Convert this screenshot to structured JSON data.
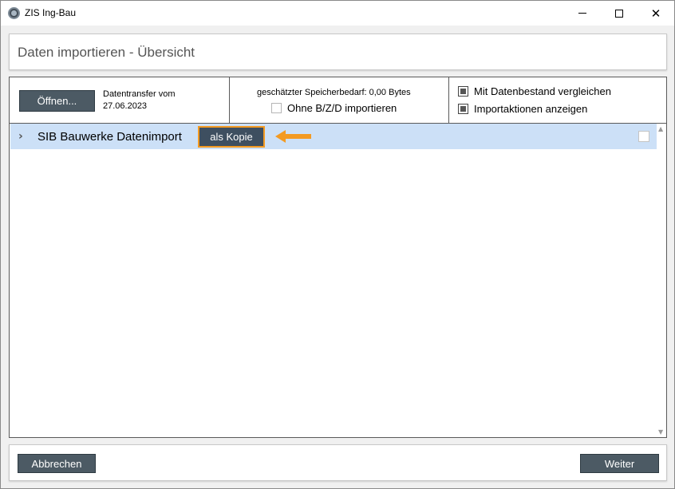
{
  "window": {
    "title": "ZIS Ing-Bau",
    "close_glyph": "✕"
  },
  "header": {
    "title": "Daten importieren - Übersicht"
  },
  "toolbar": {
    "open_label": "Öffnen...",
    "transfer_line1": "Datentransfer vom",
    "transfer_line2": "27.06.2023",
    "storage_text": "geschätzter Speicherbedarf: 0,00 Bytes",
    "without_bzd_label": "Ohne B/Z/D importieren",
    "without_bzd_checked": false,
    "compare_label": "Mit Datenbestand vergleichen",
    "compare_checked": true,
    "show_actions_label": "Importaktionen anzeigen",
    "show_actions_checked": true
  },
  "list": {
    "rows": [
      {
        "expander_glyph": "›",
        "label": "SIB Bauwerke Datenimport",
        "copy_button_label": "als Kopie",
        "checked": false
      }
    ]
  },
  "scrollbar": {
    "up_glyph": "▲",
    "down_glyph": "▼"
  },
  "footer": {
    "cancel_label": "Abbrechen",
    "next_label": "Weiter"
  },
  "colors": {
    "selected_row": "#cce0f7",
    "button_dark": "#4c5a64",
    "highlight_orange": "#f39a22"
  }
}
